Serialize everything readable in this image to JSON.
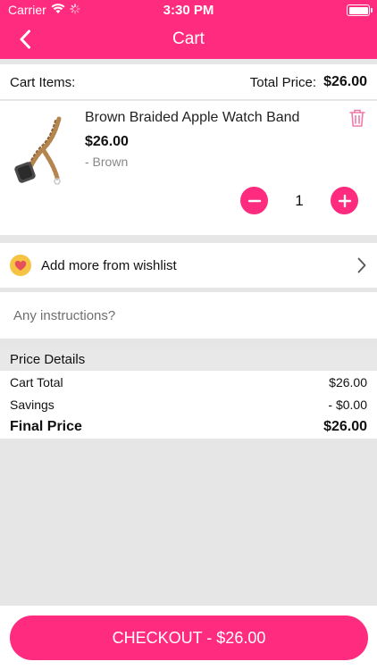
{
  "status_bar": {
    "carrier": "Carrier",
    "time": "3:30 PM"
  },
  "nav": {
    "title": "Cart"
  },
  "cart_header": {
    "items_label": "Cart Items:",
    "total_label": "Total Price:",
    "total_value": "$26.00"
  },
  "cart_items": [
    {
      "name": "Brown Braided Apple Watch Band",
      "price": "$26.00",
      "variant": "- Brown",
      "quantity": "1"
    }
  ],
  "wishlist": {
    "label": "Add more from wishlist"
  },
  "instructions": {
    "placeholder": "Any instructions?"
  },
  "price_details": {
    "title": "Price Details",
    "cart_total_label": "Cart Total",
    "cart_total_value": "$26.00",
    "savings_label": "Savings",
    "savings_value": "- $0.00",
    "final_label": "Final Price",
    "final_value": "$26.00"
  },
  "checkout": {
    "label": "CHECKOUT - $26.00"
  },
  "colors": {
    "accent": "#ff2b7f",
    "wish_badge": "#f7c343"
  }
}
